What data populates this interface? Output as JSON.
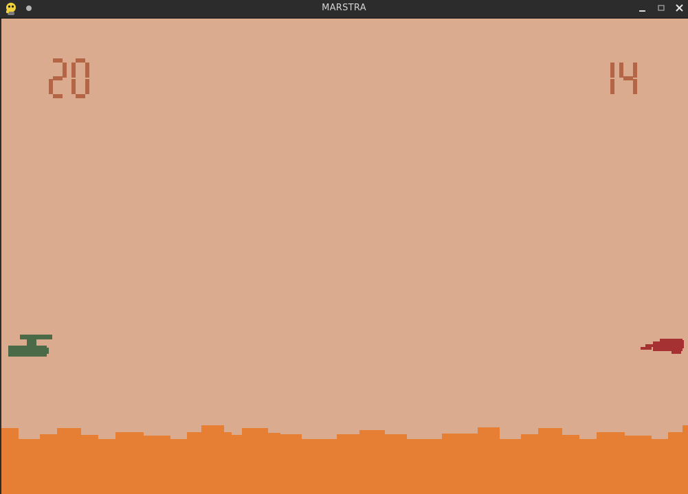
{
  "window": {
    "title": "MARSTRA",
    "app_icon": "python-snake-icon",
    "controls": [
      "minimize-icon",
      "maximize-icon",
      "close-icon"
    ]
  },
  "game": {
    "score_left": "20",
    "score_right": "14",
    "colors": {
      "sky": "#dbab8f",
      "ground": "#e67f33",
      "digits": "#b46545",
      "player_left_tank": "#4b6a47",
      "player_right_jet": "#a63132"
    },
    "objects": {
      "left_player": "green-tank",
      "right_player": "red-jet"
    }
  }
}
